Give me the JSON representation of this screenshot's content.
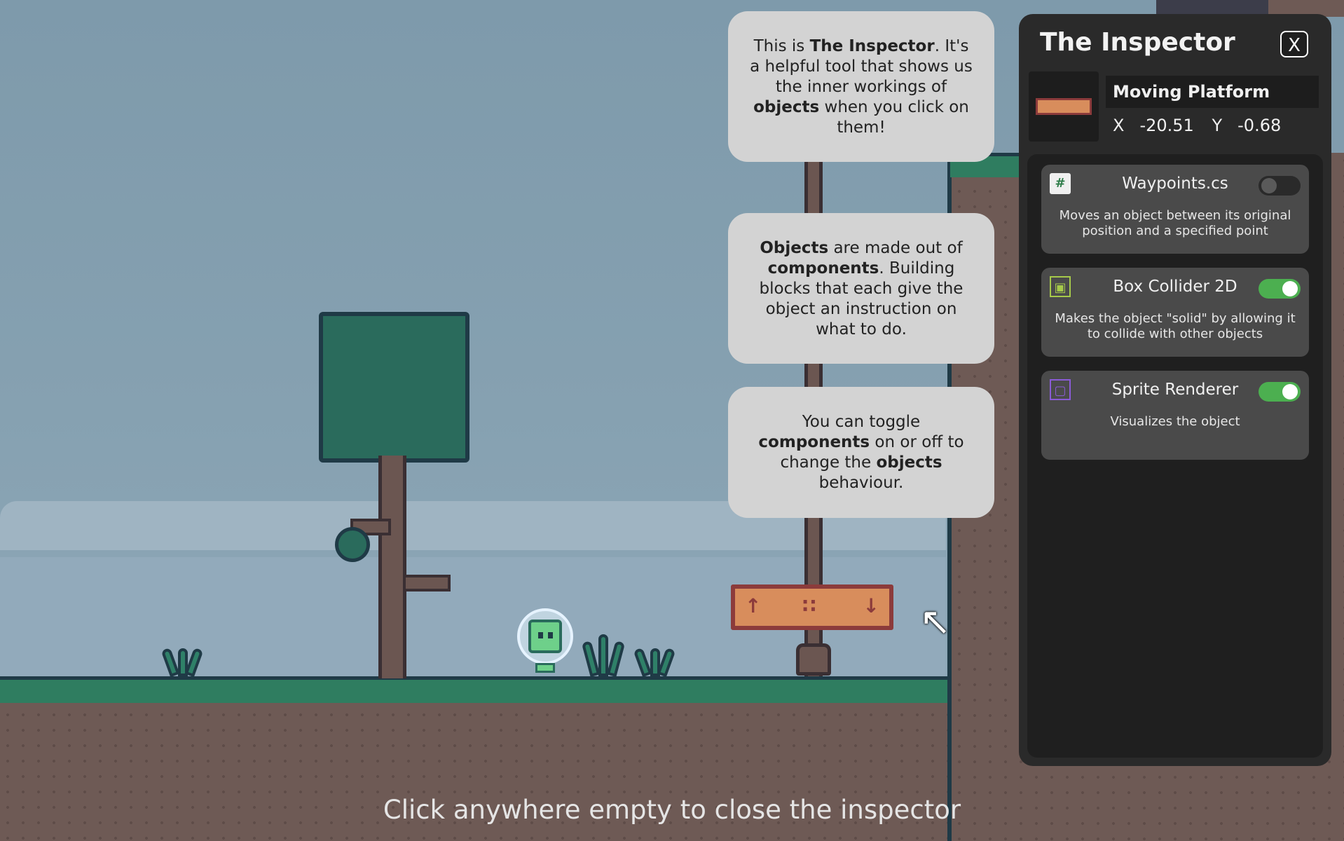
{
  "scene": {
    "tutorial_bubbles": [
      {
        "parts": [
          {
            "t": "This is "
          },
          {
            "t": "The Inspector",
            "b": true
          },
          {
            "t": ". It's a helpful tool that shows us the inner workings of "
          },
          {
            "t": "objects",
            "b": true
          },
          {
            "t": " when you click on them!"
          }
        ]
      },
      {
        "parts": [
          {
            "t": "Objects",
            "b": true
          },
          {
            "t": " are made out of "
          },
          {
            "t": "components",
            "b": true
          },
          {
            "t": ". Building blocks that each give the object an instruction on what to do."
          }
        ]
      },
      {
        "parts": [
          {
            "t": "You can toggle "
          },
          {
            "t": "components",
            "b": true
          },
          {
            "t": " on or off to change the "
          },
          {
            "t": "objects",
            "b": true
          },
          {
            "t": " behaviour."
          }
        ]
      }
    ],
    "bottom_hint": "Click anywhere empty to close the inspector",
    "platform_glyphs": [
      "↑",
      "∷",
      "↓"
    ],
    "cursor_glyph": "↖"
  },
  "inspector": {
    "title": "The Inspector",
    "close_label": "X",
    "object": {
      "name": "Moving Platform",
      "x_label": "X",
      "x_value": "-20.51",
      "y_label": "Y",
      "y_value": "-0.68"
    },
    "components": [
      {
        "icon": "script-icon",
        "icon_glyph": "#",
        "name": "Waypoints.cs",
        "enabled": false,
        "description": "Moves an object between its original position and a specified point"
      },
      {
        "icon": "box-collider-icon",
        "icon_glyph": "▣",
        "name": "Box Collider 2D",
        "enabled": true,
        "description": "Makes the object \"solid\" by allowing it to collide with other objects"
      },
      {
        "icon": "sprite-renderer-icon",
        "icon_glyph": "▢",
        "name": "Sprite Renderer",
        "enabled": true,
        "description": "Visualizes the object"
      }
    ]
  },
  "colors": {
    "toggle_on": "#4caf50",
    "panel_bg": "#2a2a2a",
    "bubble_bg": "#d3d3d3",
    "grass": "#2f7d60",
    "platform": "#d88d5c"
  }
}
